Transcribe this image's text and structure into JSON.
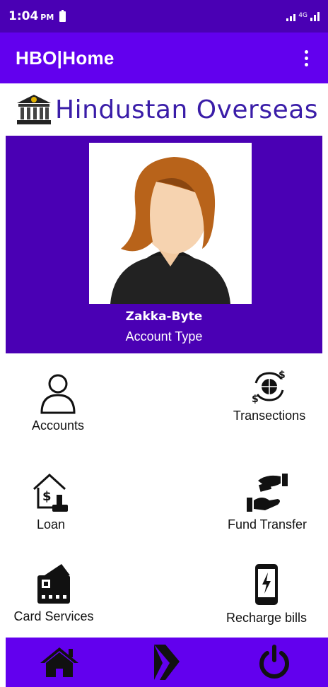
{
  "status_bar": {
    "time": "1:04",
    "ampm": "PM",
    "network": "4G"
  },
  "app_bar": {
    "title": "HBO|Home",
    "overflow_icon": "more-vert-icon"
  },
  "brand": {
    "name": "Hindustan Overseas",
    "logo_icon": "bank-icon"
  },
  "profile": {
    "name": "Zakka-Byte",
    "account_type": "Account Type",
    "avatar_icon": "female-avatar"
  },
  "menu": [
    {
      "label": "Accounts",
      "icon": "person-icon"
    },
    {
      "label": "Transections",
      "icon": "currency-exchange-icon"
    },
    {
      "label": "Loan",
      "icon": "home-loan-icon"
    },
    {
      "label": "Fund Transfer",
      "icon": "hand-money-icon"
    },
    {
      "label": "Card Services",
      "icon": "card-icon"
    },
    {
      "label": "Recharge bills",
      "icon": "mobile-recharge-icon"
    }
  ],
  "bottom_nav": [
    {
      "icon": "home-icon"
    },
    {
      "icon": "arrow-forward-icon"
    },
    {
      "icon": "power-icon"
    }
  ],
  "colors": {
    "status_bar": "#4A00B4",
    "app_bar": "#6200EE",
    "brand_text": "#3A1DA8"
  }
}
